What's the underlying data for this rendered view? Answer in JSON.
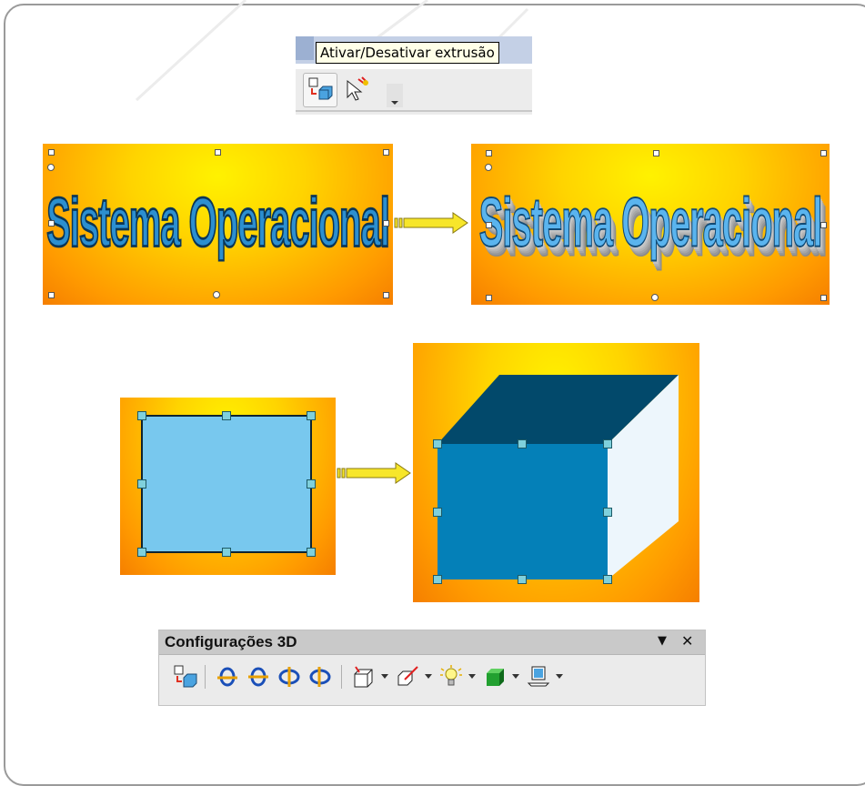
{
  "tooltip": {
    "text": "Ativar/Desativar extrusão"
  },
  "top_toolbar": {
    "buttons": [
      {
        "name": "toggle-extrusion-icon"
      },
      {
        "name": "points-icon"
      }
    ]
  },
  "fontwork": {
    "text": "Sistema Operacional"
  },
  "settings_3d": {
    "title": "Configurações 3D",
    "menu_glyph": "▼",
    "close_glyph": "✕",
    "icons": [
      "toggle-extrusion-icon",
      "tilt-down-icon",
      "tilt-up-icon",
      "tilt-left-icon",
      "tilt-right-icon",
      "depth-icon",
      "direction-icon",
      "lighting-icon",
      "surface-icon",
      "3d-color-icon"
    ]
  },
  "colors": {
    "shape_flat": "#78c8ee",
    "cube_front": "#0480b8",
    "cube_top": "#02496b",
    "cube_side": "#edf6fc",
    "arrow": "#f7e62a"
  }
}
